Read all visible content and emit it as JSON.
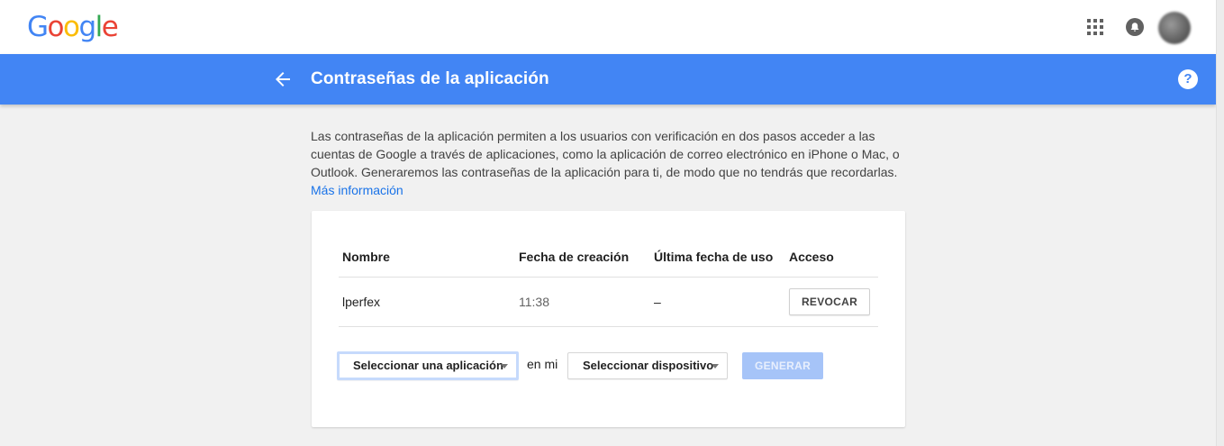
{
  "header": {
    "logo_letters": [
      {
        "ch": "G",
        "color": "#4285f4"
      },
      {
        "ch": "o",
        "color": "#ea4335"
      },
      {
        "ch": "o",
        "color": "#fbbc05"
      },
      {
        "ch": "g",
        "color": "#4285f4"
      },
      {
        "ch": "l",
        "color": "#34a853"
      },
      {
        "ch": "e",
        "color": "#ea4335"
      }
    ],
    "icons": [
      "apps-icon",
      "notifications-icon",
      "avatar"
    ]
  },
  "title_bar": {
    "title": "Contraseñas de la aplicación",
    "back_icon": "arrow-left-icon",
    "help_icon": "help-icon",
    "help_glyph": "?",
    "color": "#4285f4"
  },
  "description": {
    "text": "Las contraseñas de la aplicación permiten a los usuarios con verificación en dos pasos acceder a las cuentas de Google a través de aplicaciones, como la aplicación de correo electrónico en iPhone o Mac, o Outlook. Generaremos las contraseñas de la aplicación para ti, de modo que no tendrás que recordarlas.",
    "link": "Más información"
  },
  "table": {
    "columns": [
      "Nombre",
      "Fecha de creación",
      "Última fecha de uso",
      "Acceso"
    ],
    "rows": [
      {
        "name": "lperfex",
        "created": "11:38",
        "last_used": "–",
        "action": "REVOCAR"
      }
    ]
  },
  "generator": {
    "app_select": "Seleccionar una aplicación",
    "joiner": "en mi",
    "device_select": "Seleccionar dispositivo",
    "generate_button": "GENERAR"
  }
}
